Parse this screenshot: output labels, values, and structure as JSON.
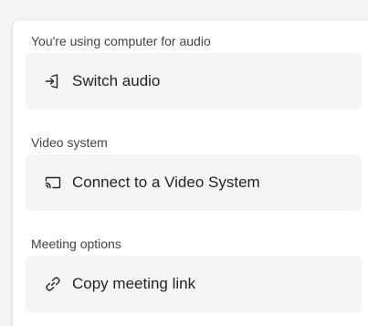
{
  "audio_section": {
    "heading": "You're using computer for audio",
    "action_label": "Switch audio",
    "icon": "switch-audio-icon"
  },
  "video_section": {
    "heading": "Video system",
    "action_label": "Connect to a Video System",
    "icon": "cast-screen-icon"
  },
  "meeting_section": {
    "heading": "Meeting options",
    "action_label": "Copy meeting link",
    "icon": "link-icon"
  }
}
